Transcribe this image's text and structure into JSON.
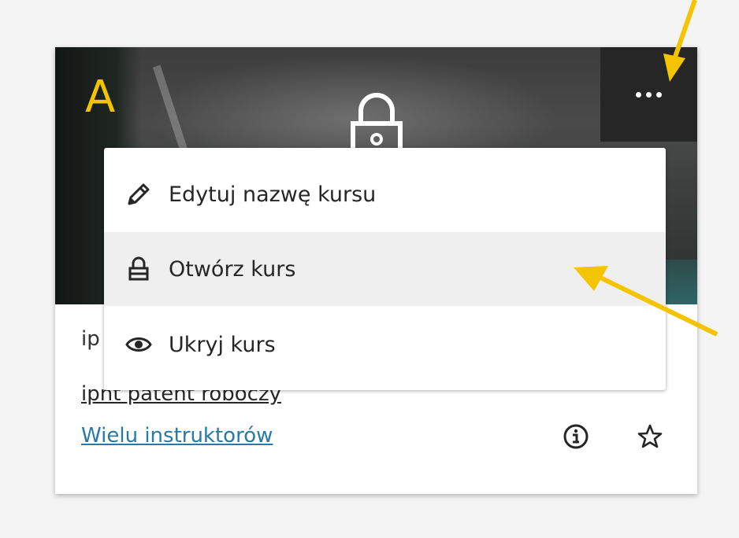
{
  "course_card": {
    "badge_letter": "A",
    "title": "ip",
    "subtitle": "ipnt patent roboczy",
    "instructors_link": "Wielu instruktorów"
  },
  "menu": {
    "items": [
      {
        "label": "Edytuj nazwę kursu",
        "icon": "pencil-icon"
      },
      {
        "label": "Otwórz kurs",
        "icon": "lock-icon"
      },
      {
        "label": "Ukryj kurs",
        "icon": "eye-icon"
      }
    ]
  },
  "colors": {
    "annotation": "#f5c400",
    "link": "#2779a7",
    "more_button_bg": "#262626",
    "menu_hover": "#efefef"
  }
}
